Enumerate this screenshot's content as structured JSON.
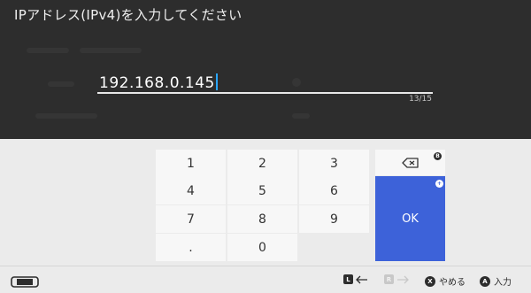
{
  "title": "IPアドレス(IPv4)を入力してください",
  "input": {
    "value": "192.168.0.145",
    "counter": "13/15"
  },
  "keypad": {
    "keys": [
      "1",
      "2",
      "3",
      "4",
      "5",
      "6",
      "7",
      "8",
      "9",
      ".",
      "0"
    ],
    "backspace_badge": "B",
    "ok_label": "OK",
    "ok_badge": "+"
  },
  "footer": {
    "left_badge": "L",
    "right_badge": "R",
    "cancel_badge": "X",
    "cancel_label": "やめる",
    "confirm_badge": "A",
    "confirm_label": "入力"
  }
}
